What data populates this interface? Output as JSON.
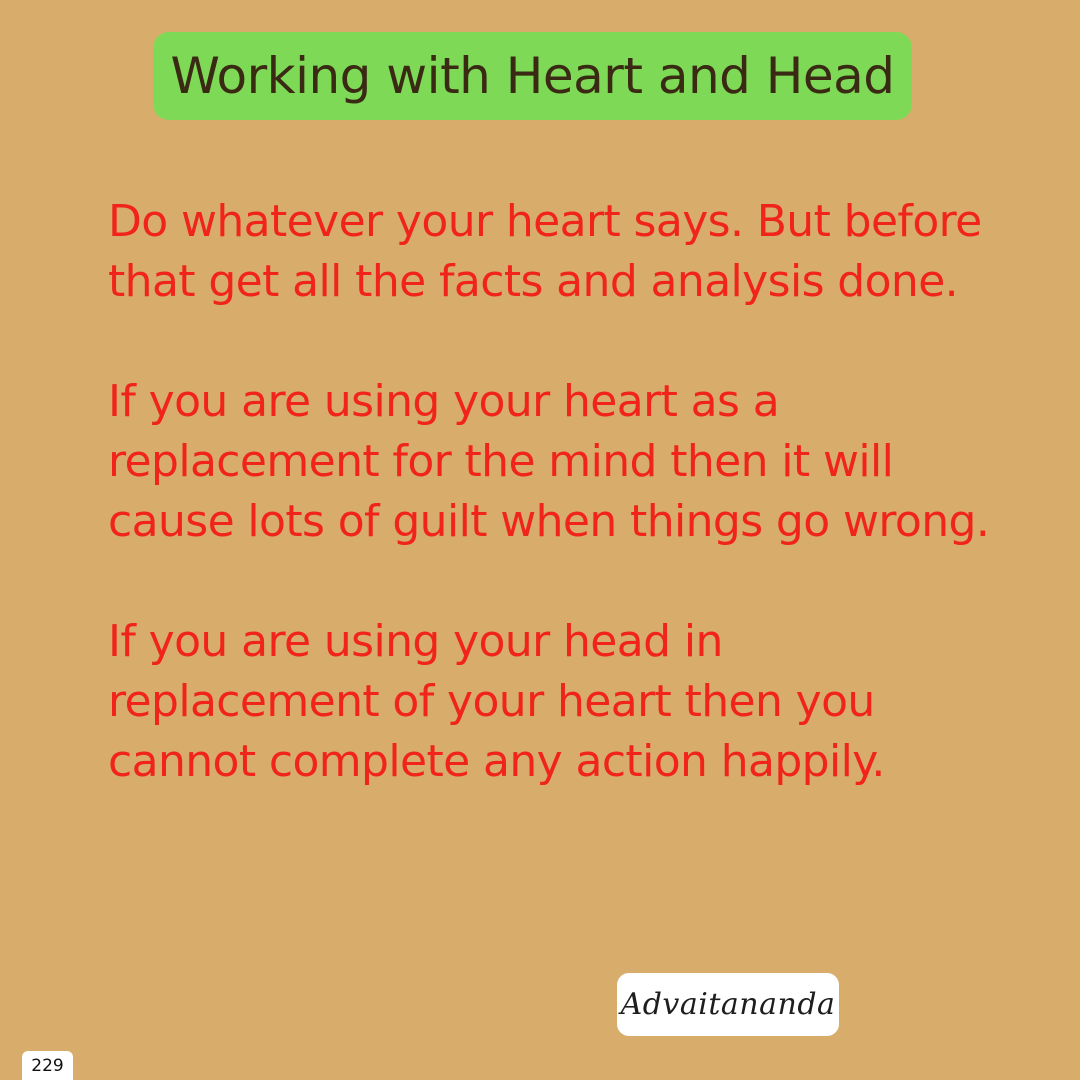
{
  "title": "Working with Heart and Head",
  "paragraphs": [
    [
      "Do whatever your heart says. But before",
      "that get all the facts and analysis done."
    ],
    [
      "If you are using your heart as a",
      "replacement for the mind then it will",
      "cause lots of guilt when things go wrong."
    ],
    [
      "If you are using your head in",
      "replacement of your heart then you",
      "cannot complete any action happily."
    ]
  ],
  "signature": "Advaitananda",
  "page_number": "229",
  "colors": {
    "background": "#D8AC6B",
    "title_box": "#7ED957",
    "title_text": "#3A2A14",
    "body_text": "#F0241A"
  }
}
